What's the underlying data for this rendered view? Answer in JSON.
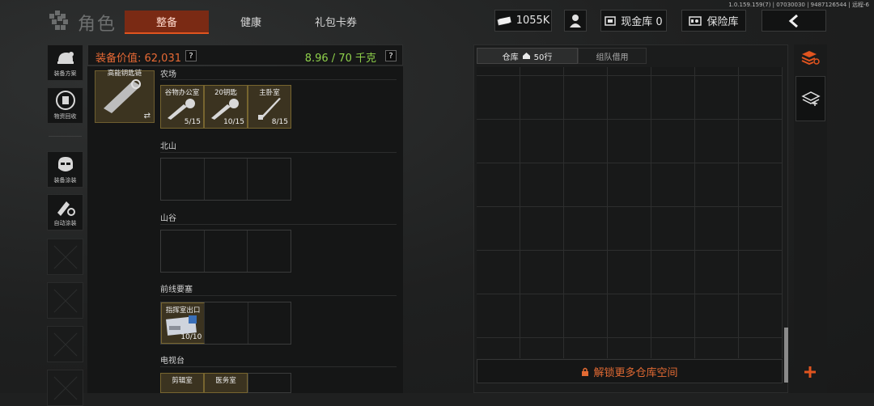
{
  "build_info": "1.0.159.159(7) | 07030030 | 9487126544 | 远程-6",
  "brand": {
    "title": "角色"
  },
  "tabs": [
    {
      "label": "整备",
      "active": true
    },
    {
      "label": "健康",
      "active": false
    },
    {
      "label": "礼包卡券",
      "active": false
    }
  ],
  "top_buttons": {
    "money": "1055K",
    "cash_vault": "现金库 0",
    "safe": "保险库"
  },
  "side_menu": [
    {
      "label": "装备方案",
      "icon": "helmet-icon"
    },
    {
      "label": "物资回收",
      "icon": "recycle-icon"
    },
    {
      "label": "装备涂装",
      "icon": "mask-icon"
    },
    {
      "label": "自动涂装",
      "icon": "spray-icon"
    }
  ],
  "equipment": {
    "value_label": "装备价值: 62,031",
    "weight_label": "8.96 / 70 千克",
    "help": "?"
  },
  "keychain": {
    "name": "高能钥匙链",
    "swap_icon": "swap-icon"
  },
  "sections": [
    {
      "name": "农场",
      "items": [
        {
          "name": "谷物办公室",
          "count": "5/15"
        },
        {
          "name": "20钥匙",
          "count": "10/15"
        },
        {
          "name": "主卧室",
          "count": "8/15"
        }
      ]
    },
    {
      "name": "北山",
      "items": []
    },
    {
      "name": "山谷",
      "items": []
    },
    {
      "name": "前线要塞",
      "items": [
        {
          "name": "指挥室出口",
          "count": "10/10"
        }
      ]
    },
    {
      "name": "电视台",
      "items": [
        {
          "name": "剪辑室",
          "count": ""
        },
        {
          "name": "医务室",
          "count": ""
        }
      ]
    }
  ],
  "warehouse": {
    "tab_label": "仓库",
    "rows_label": "50行",
    "team_tab": "组队借用",
    "unlock_label": "解锁更多仓库空间"
  },
  "colors": {
    "accent": "#e0541f",
    "weight_green": "#8fd14b",
    "item_gold": "#3b3320"
  }
}
